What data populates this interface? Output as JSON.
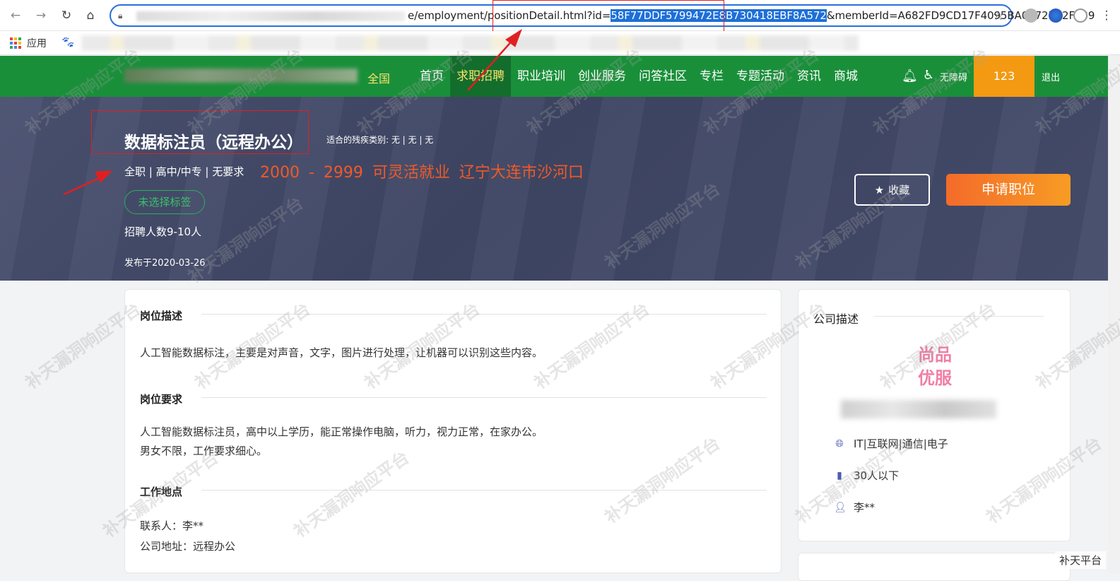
{
  "browser": {
    "url_prefix": "e/employment/positionDetail.html?id=",
    "url_id": "58F77DDF5799472E8B730418EBF8A572",
    "url_suffix": "&memberId=A682FD9CD17F4095BA0472BE2F239",
    "apps_label": "应用"
  },
  "header": {
    "region": "全国",
    "menu": [
      {
        "label": "首页",
        "active": false
      },
      {
        "label": "求职招聘",
        "active": true
      },
      {
        "label": "职业培训",
        "active": false
      },
      {
        "label": "创业服务",
        "active": false
      },
      {
        "label": "问答社区",
        "active": false
      },
      {
        "label": "专栏",
        "active": false
      },
      {
        "label": "专题活动",
        "active": false
      },
      {
        "label": "资讯",
        "active": false
      },
      {
        "label": "商城",
        "active": false
      }
    ],
    "accessibility_label": "无障碍",
    "username": "123",
    "logout_label": "退出"
  },
  "job": {
    "title": "数据标注员（远程办公）",
    "disability_types": "适合的残疾类别: 无 | 无 | 无",
    "meta": "全职 | 高中/中专 | 无要求",
    "highlight": "2000 - 2999  可灵活就业  辽宁大连市沙河口",
    "tag": "未选择标签",
    "hire_count": "招聘人数9-10人",
    "publish_date": "发布于2020-03-26",
    "favorite_label": "收藏",
    "apply_label": "申请职位"
  },
  "sections": {
    "desc_title": "岗位描述",
    "desc_text": "人工智能数据标注，主要是对声音，文字，图片进行处理，让机器可以识别这些内容。",
    "req_title": "岗位要求",
    "req_line1": "人工智能数据标注员，高中以上学历，能正常操作电脑，听力，视力正常，在家办公。",
    "req_line2": "男女不限，工作要求细心。",
    "loc_title": "工作地点",
    "contact": "联系人：李**",
    "address": "公司地址：远程办公"
  },
  "company": {
    "title": "公司描述",
    "logo_line1": "尚品",
    "logo_line2": "优服",
    "industry": "IT|互联网|通信|电子",
    "size": "30人以下",
    "contact": "李**"
  },
  "watermark": {
    "text": "补天漏洞响应平台",
    "corner": "补天平台"
  },
  "colors": {
    "header_green": "#1a8f3a",
    "active_yellow": "#f7e26b",
    "highlight_orange": "#f05a28",
    "annotation_red": "#e02020"
  }
}
